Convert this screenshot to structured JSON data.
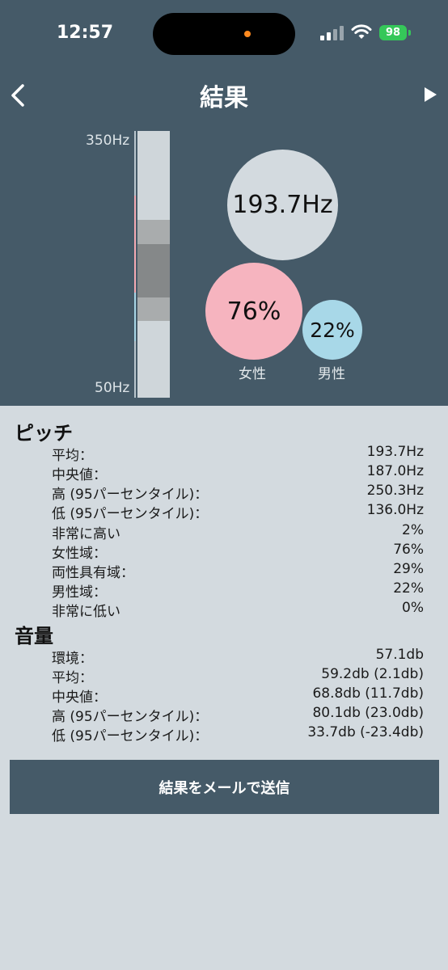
{
  "status": {
    "time": "12:57",
    "battery": "98"
  },
  "header": {
    "title": "結果"
  },
  "pitch_bar": {
    "top_label": "350Hz",
    "bottom_label": "50Hz"
  },
  "bubbles": {
    "average": "193.7Hz",
    "female_pct": "76%",
    "male_pct": "22%",
    "female_label": "女性",
    "male_label": "男性"
  },
  "colors": {
    "header_bg": "#455a68",
    "female": "#f6b4bf",
    "male": "#a8d8e8",
    "body_bg": "#d3dadf"
  },
  "pitch": {
    "title": "ピッチ",
    "rows": [
      {
        "label": "平均：",
        "value": "193.7Hz"
      },
      {
        "label": "中央値：",
        "value": "187.0Hz"
      },
      {
        "label": "高 (95パーセンタイル)：",
        "value": "250.3Hz"
      },
      {
        "label": "低 (95パーセンタイル)：",
        "value": "136.0Hz"
      },
      {
        "label": "非常に高い",
        "value": "2%"
      },
      {
        "label": "女性域：",
        "value": "76%"
      },
      {
        "label": "両性具有域：",
        "value": "29%"
      },
      {
        "label": "男性域：",
        "value": "22%"
      },
      {
        "label": "非常に低い",
        "value": "0%"
      }
    ]
  },
  "volume": {
    "title": "音量",
    "rows": [
      {
        "label": "環境：",
        "value": "57.1db"
      },
      {
        "label": "平均：",
        "value": "59.2db (2.1db)"
      },
      {
        "label": "中央値：",
        "value": "68.8db (11.7db)"
      },
      {
        "label": "高 (95パーセンタイル)：",
        "value": "80.1db (23.0db)"
      },
      {
        "label": "低 (95パーセンタイル)：",
        "value": "33.7db (-23.4db)"
      }
    ]
  },
  "actions": {
    "send_mail": "結果をメールで送信"
  }
}
